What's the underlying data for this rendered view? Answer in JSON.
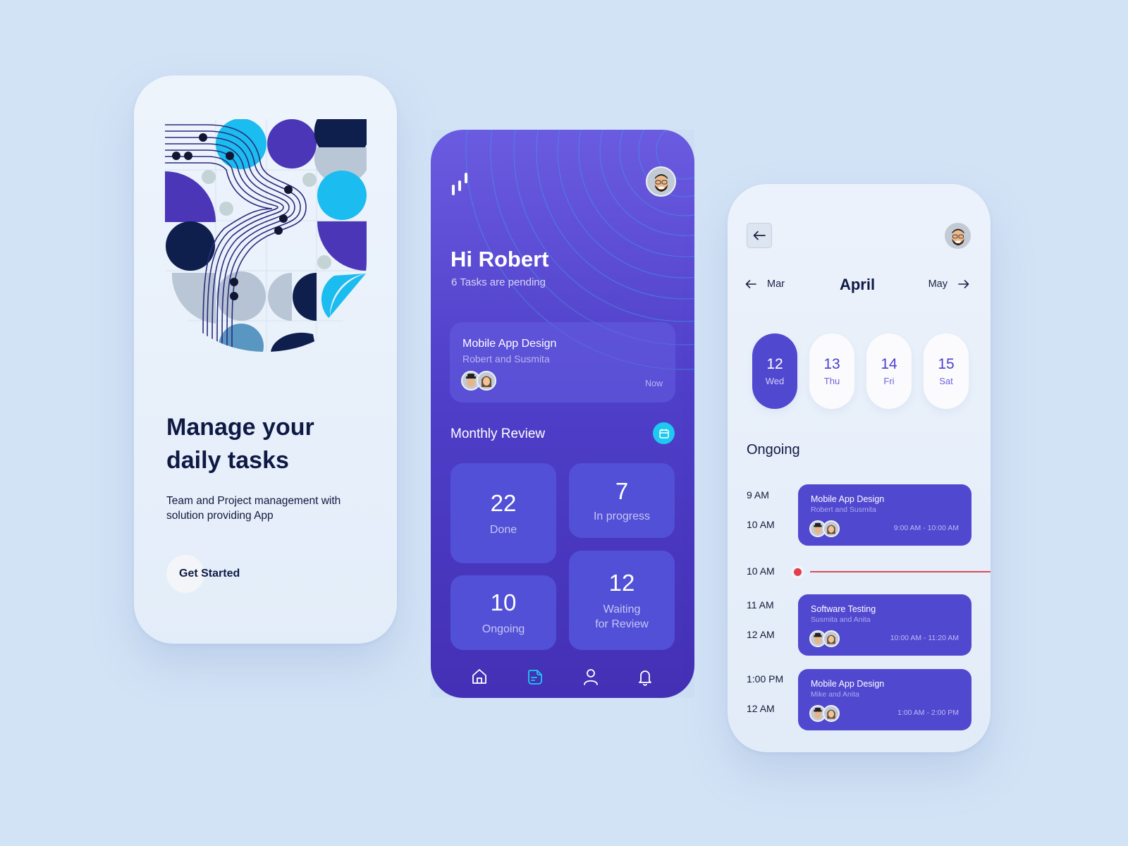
{
  "onboarding": {
    "title_line1": "Manage your",
    "title_line2": "daily tasks",
    "subtitle_line1": "Team and Project management with",
    "subtitle_line2": "solution providing App",
    "cta_label": "Get Started",
    "illustration": "geometric-pattern-illustration"
  },
  "dashboard": {
    "logo": "bars-logo-icon",
    "greeting": "Hi Robert",
    "pending": "6 Tasks are pending",
    "current_task": {
      "title": "Mobile App Design",
      "people": "Robert and Susmita",
      "time": "Now"
    },
    "review_title": "Monthly Review",
    "stats": [
      {
        "value": "22",
        "label": "Done"
      },
      {
        "value": "7",
        "label": "In progress"
      },
      {
        "value": "10",
        "label": "Ongoing"
      },
      {
        "value": "12",
        "label_line1": "Waiting",
        "label_line2": "for Review"
      }
    ],
    "nav": [
      {
        "icon": "home-icon",
        "active": false
      },
      {
        "icon": "document-icon",
        "active": true
      },
      {
        "icon": "profile-icon",
        "active": false
      },
      {
        "icon": "bell-icon",
        "active": false
      }
    ],
    "colors": {
      "accent": "#1ec8f0",
      "primary": "#5148d0"
    }
  },
  "calendar": {
    "prev_month": "Mar",
    "month": "April",
    "next_month": "May",
    "days": [
      {
        "num": "12",
        "dow": "Wed",
        "active": true
      },
      {
        "num": "13",
        "dow": "Thu",
        "active": false
      },
      {
        "num": "14",
        "dow": "Fri",
        "active": false
      },
      {
        "num": "15",
        "dow": "Sat",
        "active": false
      }
    ],
    "section_title": "Ongoing",
    "now_label": "10 AM",
    "events": [
      {
        "start_label": "9 AM",
        "end_label": "10 AM",
        "title": "Mobile App Design",
        "people": "Robert and Susmita",
        "range": "9:00 AM - 10:00 AM"
      },
      {
        "start_label": "11 AM",
        "end_label": "12 AM",
        "title": "Software Testing",
        "people": "Susmita and Anita",
        "range": "10:00 AM - 11:20 AM"
      },
      {
        "start_label": "1:00 PM",
        "end_label": "12 AM",
        "title": "Mobile App Design",
        "people": "Mike and Anita",
        "range": "1:00 AM - 2:00 PM"
      }
    ],
    "colors": {
      "now_indicator": "#e23e4f"
    }
  }
}
